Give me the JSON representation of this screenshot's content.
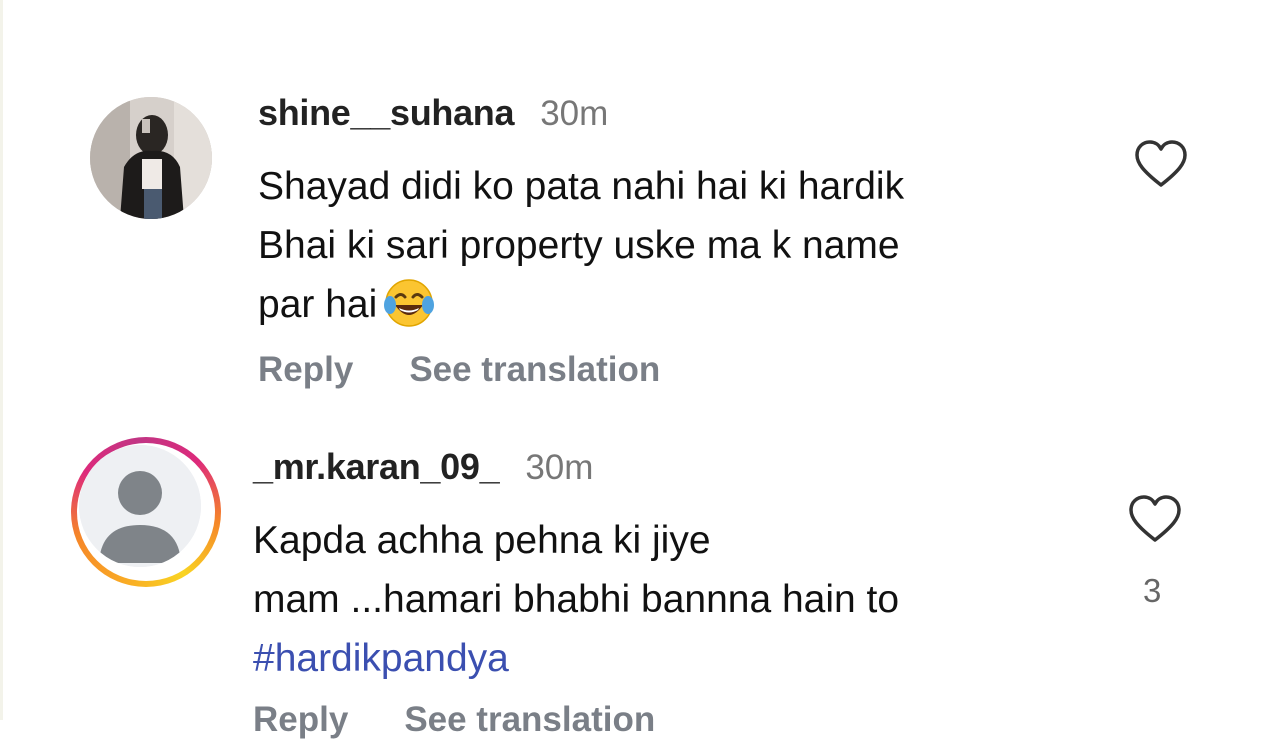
{
  "comments": [
    {
      "username": "shine__suhana",
      "time": "30m",
      "lines": [
        "Shayad didi ko pata nahi hai ki hardik",
        "Bhai ki sari property uske ma k name",
        "par hai"
      ],
      "emoji": "face-with-tears-of-joy",
      "reply_label": "Reply",
      "translate_label": "See translation",
      "like_count": "",
      "avatar": "user-photo"
    },
    {
      "username": "_mr.karan_09_",
      "time": "30m",
      "lines": [
        "Kapda achha pehna ki jiye",
        "mam ...hamari bhabhi bannna hain to"
      ],
      "hashtag": "#hardikpandya",
      "reply_label": "Reply",
      "translate_label": "See translation",
      "like_count": "3",
      "avatar": "default-avatar",
      "story_ring": true
    }
  ],
  "icons": {
    "like": "heart-outline-icon"
  },
  "colors": {
    "hashtag": "#3b4fb0",
    "muted": "#7a7f87",
    "username": "#222222"
  }
}
